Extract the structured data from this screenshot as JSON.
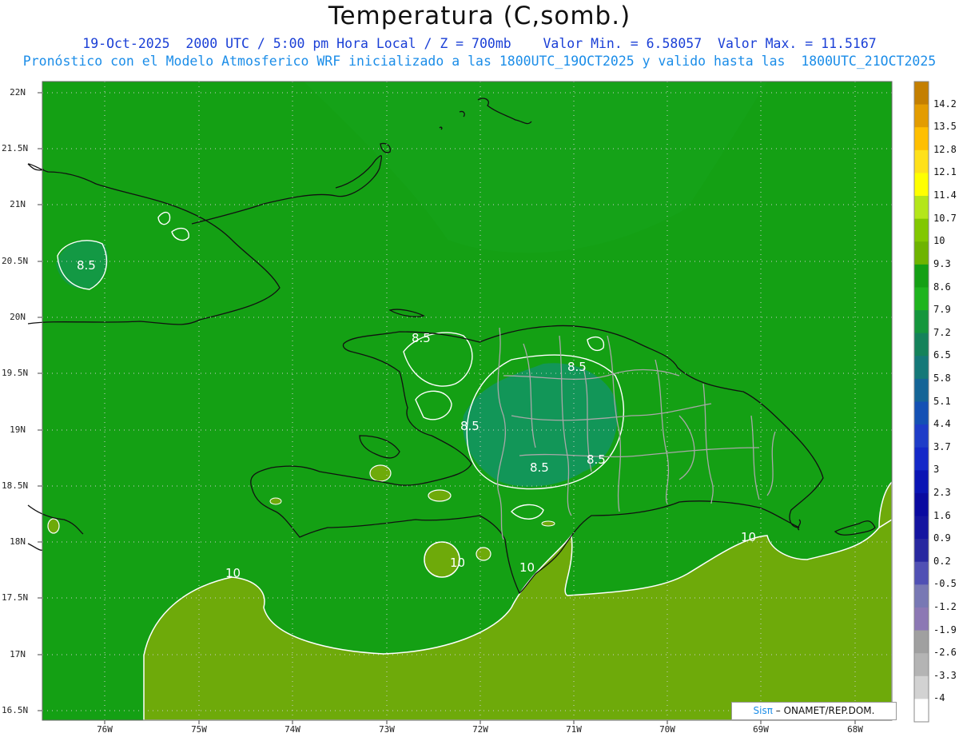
{
  "title": "Temperatura (C,somb.)",
  "subtitle_line1": "19-Oct-2025  2000 UTC / 5:00 pm Hora Local / Z = 700mb    Valor Min. = 6.58057  Valor Max. = 11.5167",
  "subtitle_line2": "Pronóstico con el Modelo Atmosferico WRF inicializado a las 1800UTC_19OCT2025 y valido hasta las  1800UTC_21OCT2025",
  "latitude_labels": [
    "22N",
    "21.5N",
    "21N",
    "20.5N",
    "20N",
    "19.5N",
    "19N",
    "18.5N",
    "18N",
    "17.5N",
    "17N",
    "16.5N"
  ],
  "longitude_labels": [
    "76W",
    "75W",
    "74W",
    "73W",
    "72W",
    "71W",
    "70W",
    "69W",
    "68W"
  ],
  "colorbar": {
    "labels": [
      "14.2",
      "13.5",
      "12.8",
      "12.1",
      "11.4",
      "10.7",
      "10",
      "9.3",
      "8.6",
      "7.9",
      "7.2",
      "6.5",
      "5.8",
      "5.1",
      "4.4",
      "3.7",
      "3",
      "2.3",
      "1.6",
      "0.9",
      "0.2",
      "-0.5",
      "-1.2",
      "-1.9",
      "-2.6",
      "-3.3",
      "-4"
    ],
    "colors": [
      "#c47f00",
      "#e39c00",
      "#ffbf00",
      "#ffe11a",
      "#ffff00",
      "#b4e61a",
      "#82c800",
      "#6eb400",
      "#14a014",
      "#1eb41e",
      "#14963c",
      "#14825a",
      "#147878",
      "#146496",
      "#1450b4",
      "#1e3cc8",
      "#1428c8",
      "#0a14b4",
      "#0a0aa0",
      "#1414a0",
      "#2828a0",
      "#5050b4",
      "#7878b4",
      "#8c78b4",
      "#a0a0a0",
      "#b4b4b4",
      "#d2d2d2",
      "#ffffff"
    ]
  },
  "contour_labels": [
    "8.5",
    "8.5",
    "8.5",
    "8.5",
    "8.5",
    "8.5",
    "10",
    "10",
    "10",
    "10"
  ],
  "credit": {
    "brand": "Sisπ",
    "text": " – ONAMET/REP.DOM."
  },
  "shading": {
    "background": "#14a014",
    "warm": "#6eaa0a",
    "cool": "#129464"
  }
}
